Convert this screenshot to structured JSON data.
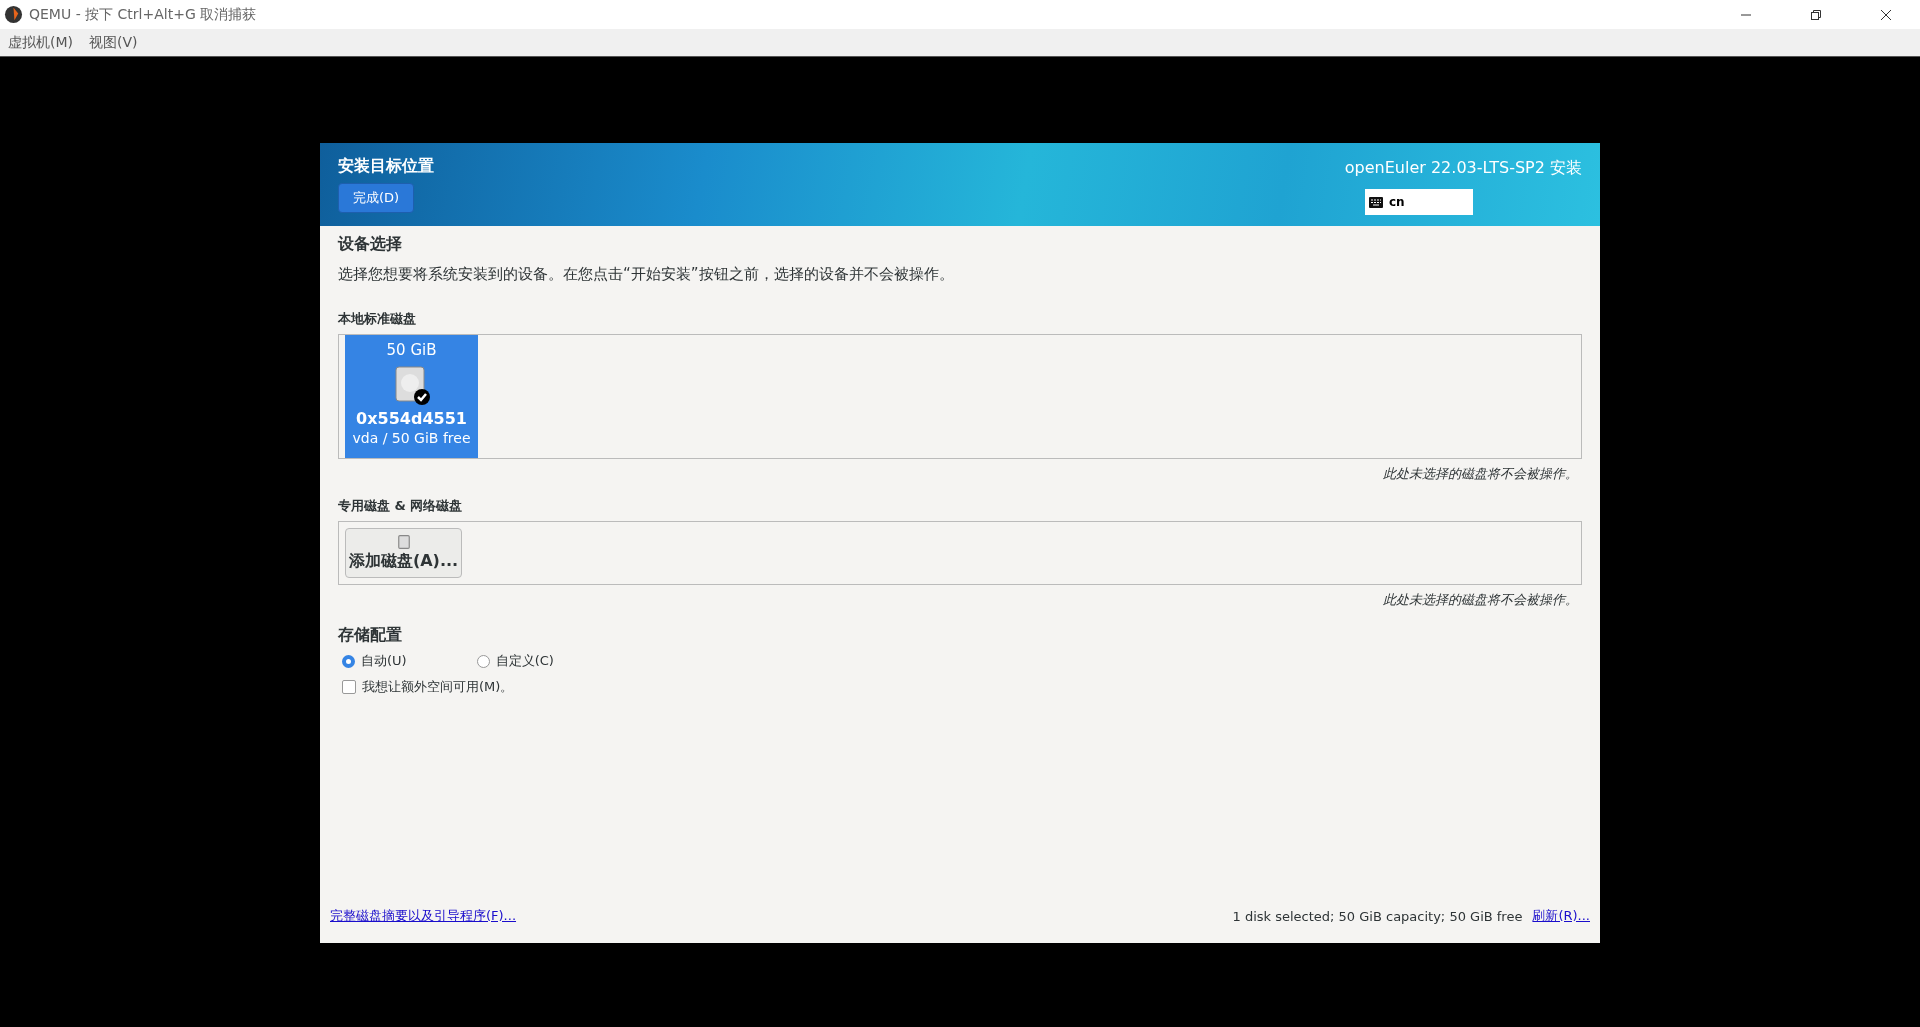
{
  "window": {
    "title": "QEMU - 按下 Ctrl+Alt+G 取消捕获"
  },
  "menu": [
    "虚拟机(M)",
    "视图(V)"
  ],
  "installer": {
    "header": {
      "title": "安装目标位置",
      "done_button": "完成(D)",
      "product": "openEuler 22.03-LTS-SP2 安装",
      "keyboard_layout": "cn"
    },
    "device_selection": {
      "title": "设备选择",
      "description": "选择您想要将系统安装到的设备。在您点击“开始安装”按钮之前，选择的设备并不会被操作。"
    },
    "local_disks": {
      "title": "本地标准磁盘",
      "disks": [
        {
          "size": "50 GiB",
          "name": "0x554d4551",
          "detail": "vda  /  50 GiB free",
          "selected": true
        }
      ],
      "note": "此处未选择的磁盘将不会被操作。"
    },
    "special_disks": {
      "title": "专用磁盘 & 网络磁盘",
      "add_button": "添加磁盘(A)...",
      "note": "此处未选择的磁盘将不会被操作。"
    },
    "storage_config": {
      "title": "存储配置",
      "options": [
        {
          "label": "自动(U)",
          "selected": true
        },
        {
          "label": "自定义(C)",
          "selected": false
        }
      ],
      "extra_space": {
        "label": "我想让额外空间可用(M)。",
        "checked": false
      }
    },
    "footer": {
      "summary_link": "完整磁盘摘要以及引导程序(F)...",
      "status": "1 disk selected; 50 GiB capacity; 50 GiB free",
      "refresh_link": "刷新(R)..."
    }
  }
}
